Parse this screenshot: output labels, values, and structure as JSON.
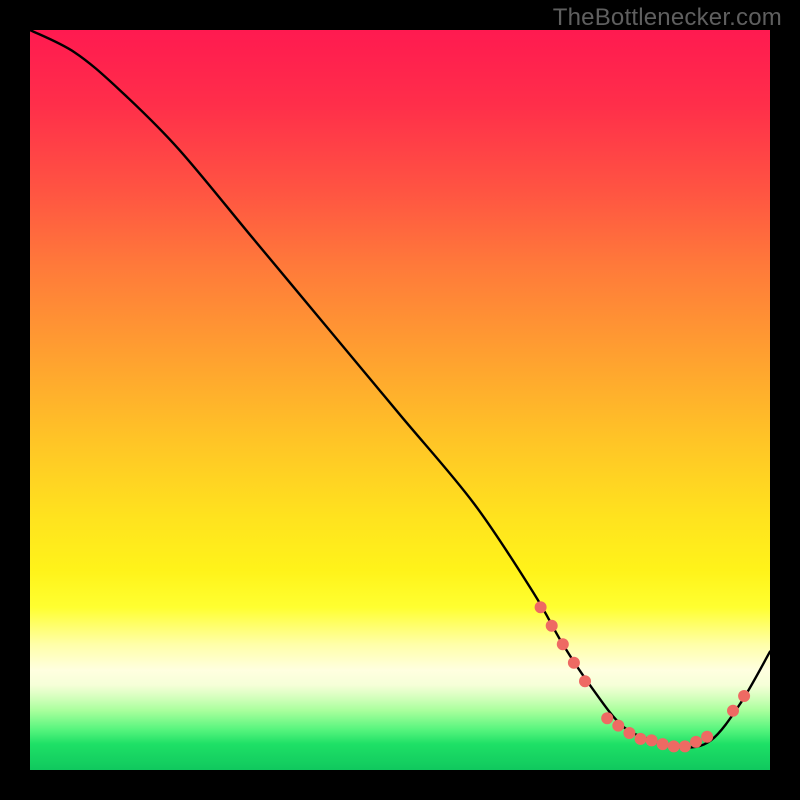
{
  "watermark": "TheBottlenecker.com",
  "chart_data": {
    "type": "line",
    "title": "",
    "xlabel": "",
    "ylabel": "",
    "xlim": [
      0,
      100
    ],
    "ylim": [
      0,
      100
    ],
    "x": [
      0,
      6,
      12,
      20,
      30,
      40,
      50,
      60,
      68,
      72,
      76,
      80,
      84,
      88,
      92,
      96,
      100
    ],
    "values": [
      100,
      97,
      92,
      84,
      72,
      60,
      48,
      36,
      24,
      17,
      11,
      6,
      4,
      3,
      4,
      9,
      16
    ],
    "series": [
      {
        "name": "curve",
        "x": [
          0,
          6,
          12,
          20,
          30,
          40,
          50,
          60,
          68,
          72,
          76,
          80,
          84,
          88,
          92,
          96,
          100
        ],
        "y": [
          100,
          97,
          92,
          84,
          72,
          60,
          48,
          36,
          24,
          17,
          11,
          6,
          4,
          3,
          4,
          9,
          16
        ]
      }
    ],
    "markers": [
      {
        "x": 69,
        "y": 22
      },
      {
        "x": 70.5,
        "y": 19.5
      },
      {
        "x": 72,
        "y": 17
      },
      {
        "x": 73.5,
        "y": 14.5
      },
      {
        "x": 75,
        "y": 12
      },
      {
        "x": 78,
        "y": 7
      },
      {
        "x": 79.5,
        "y": 6
      },
      {
        "x": 81,
        "y": 5
      },
      {
        "x": 82.5,
        "y": 4.2
      },
      {
        "x": 84,
        "y": 4
      },
      {
        "x": 85.5,
        "y": 3.5
      },
      {
        "x": 87,
        "y": 3.2
      },
      {
        "x": 88.5,
        "y": 3.2
      },
      {
        "x": 90,
        "y": 3.8
      },
      {
        "x": 91.5,
        "y": 4.5
      },
      {
        "x": 95,
        "y": 8
      },
      {
        "x": 96.5,
        "y": 10
      }
    ],
    "gradient_stops": [
      {
        "pos": 0.0,
        "color": "#ff1a50"
      },
      {
        "pos": 0.5,
        "color": "#ffc626"
      },
      {
        "pos": 0.8,
        "color": "#ffff60"
      },
      {
        "pos": 0.9,
        "color": "#d8ffc0"
      },
      {
        "pos": 1.0,
        "color": "#10c85e"
      }
    ],
    "marker_color": "#ee6a63",
    "line_color": "#000000"
  }
}
